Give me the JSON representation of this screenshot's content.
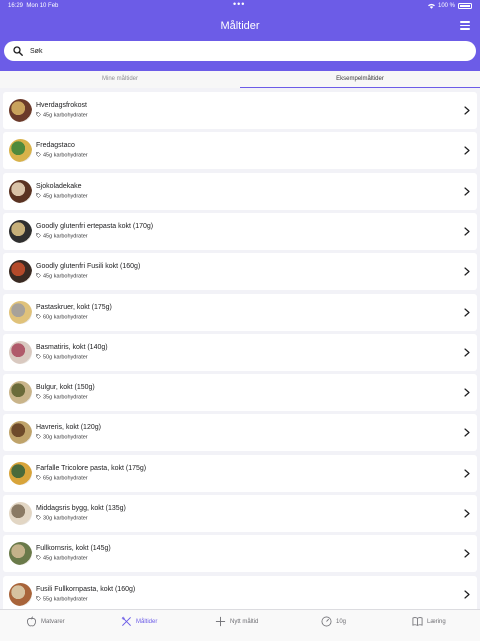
{
  "status": {
    "time": "16:29",
    "date": "Mon 10 Feb",
    "battery": "100 %"
  },
  "header": {
    "title": "Måltider",
    "menu_icon": "hamburger-icon"
  },
  "search": {
    "placeholder": "Søk",
    "value": ""
  },
  "tabs": [
    {
      "label": "Mine måltider",
      "active": false
    },
    {
      "label": "Eksempelmåltider",
      "active": true
    }
  ],
  "meals": [
    {
      "name": "Hverdagsfrokost",
      "carbs": "45g karbohydrater",
      "colors": [
        "#6b3a2a",
        "#c9a25c"
      ]
    },
    {
      "name": "Fredagstaco",
      "carbs": "45g karbohydrater",
      "colors": [
        "#d8b24a",
        "#4f8a3c"
      ]
    },
    {
      "name": "Sjokoladekake",
      "carbs": "45g karbohydrater",
      "colors": [
        "#5a3322",
        "#d9c3a8"
      ]
    },
    {
      "name": "Goodly glutenfri ertepasta kokt (170g)",
      "carbs": "45g karbohydrater",
      "colors": [
        "#2f2f2f",
        "#c7b07a"
      ]
    },
    {
      "name": "Goodly glutenfri Fusili kokt (160g)",
      "carbs": "45g karbohydrater",
      "colors": [
        "#3a2a22",
        "#b54a2a"
      ]
    },
    {
      "name": "Pastaskruer, kokt (175g)",
      "carbs": "60g karbohydrater",
      "colors": [
        "#e0c27a",
        "#a8a29a"
      ]
    },
    {
      "name": "Basmatiris, kokt (140g)",
      "carbs": "50g karbohydrater",
      "colors": [
        "#d9c9c0",
        "#b05a6a"
      ]
    },
    {
      "name": "Bulgur, kokt (150g)",
      "carbs": "35g karbohydrater",
      "colors": [
        "#c9b48a",
        "#6b6b3a"
      ]
    },
    {
      "name": "Havreris, kokt (120g)",
      "carbs": "30g karbohydrater",
      "colors": [
        "#bfa36a",
        "#6e4a2a"
      ]
    },
    {
      "name": "Farfalle Tricolore pasta, kokt (175g)",
      "carbs": "65g karbohydrater",
      "colors": [
        "#d8a43a",
        "#4a6a3a"
      ]
    },
    {
      "name": "Middagsris bygg, kokt (135g)",
      "carbs": "30g karbohydrater",
      "colors": [
        "#e2d6c4",
        "#8a7a64"
      ]
    },
    {
      "name": "Fullkornsris, kokt (145g)",
      "carbs": "45g karbohydrater",
      "colors": [
        "#6a7a4a",
        "#c4b28a"
      ]
    },
    {
      "name": "Fusili Fullkornpasta, kokt (160g)",
      "carbs": "55g karbohydrater",
      "colors": [
        "#a8643a",
        "#d6c2a0"
      ]
    }
  ],
  "tabbar": [
    {
      "label": "Matvarer",
      "icon": "apple-icon",
      "active": false
    },
    {
      "label": "Måltider",
      "icon": "utensils-icon",
      "active": true
    },
    {
      "label": "Nytt måltid",
      "icon": "plus-icon",
      "active": false
    },
    {
      "label": "10g",
      "icon": "gauge-icon",
      "active": false
    },
    {
      "label": "Læring",
      "icon": "book-icon",
      "active": false
    }
  ],
  "colors": {
    "accent": "#6c5ce7",
    "background": "#f2f2f7"
  }
}
